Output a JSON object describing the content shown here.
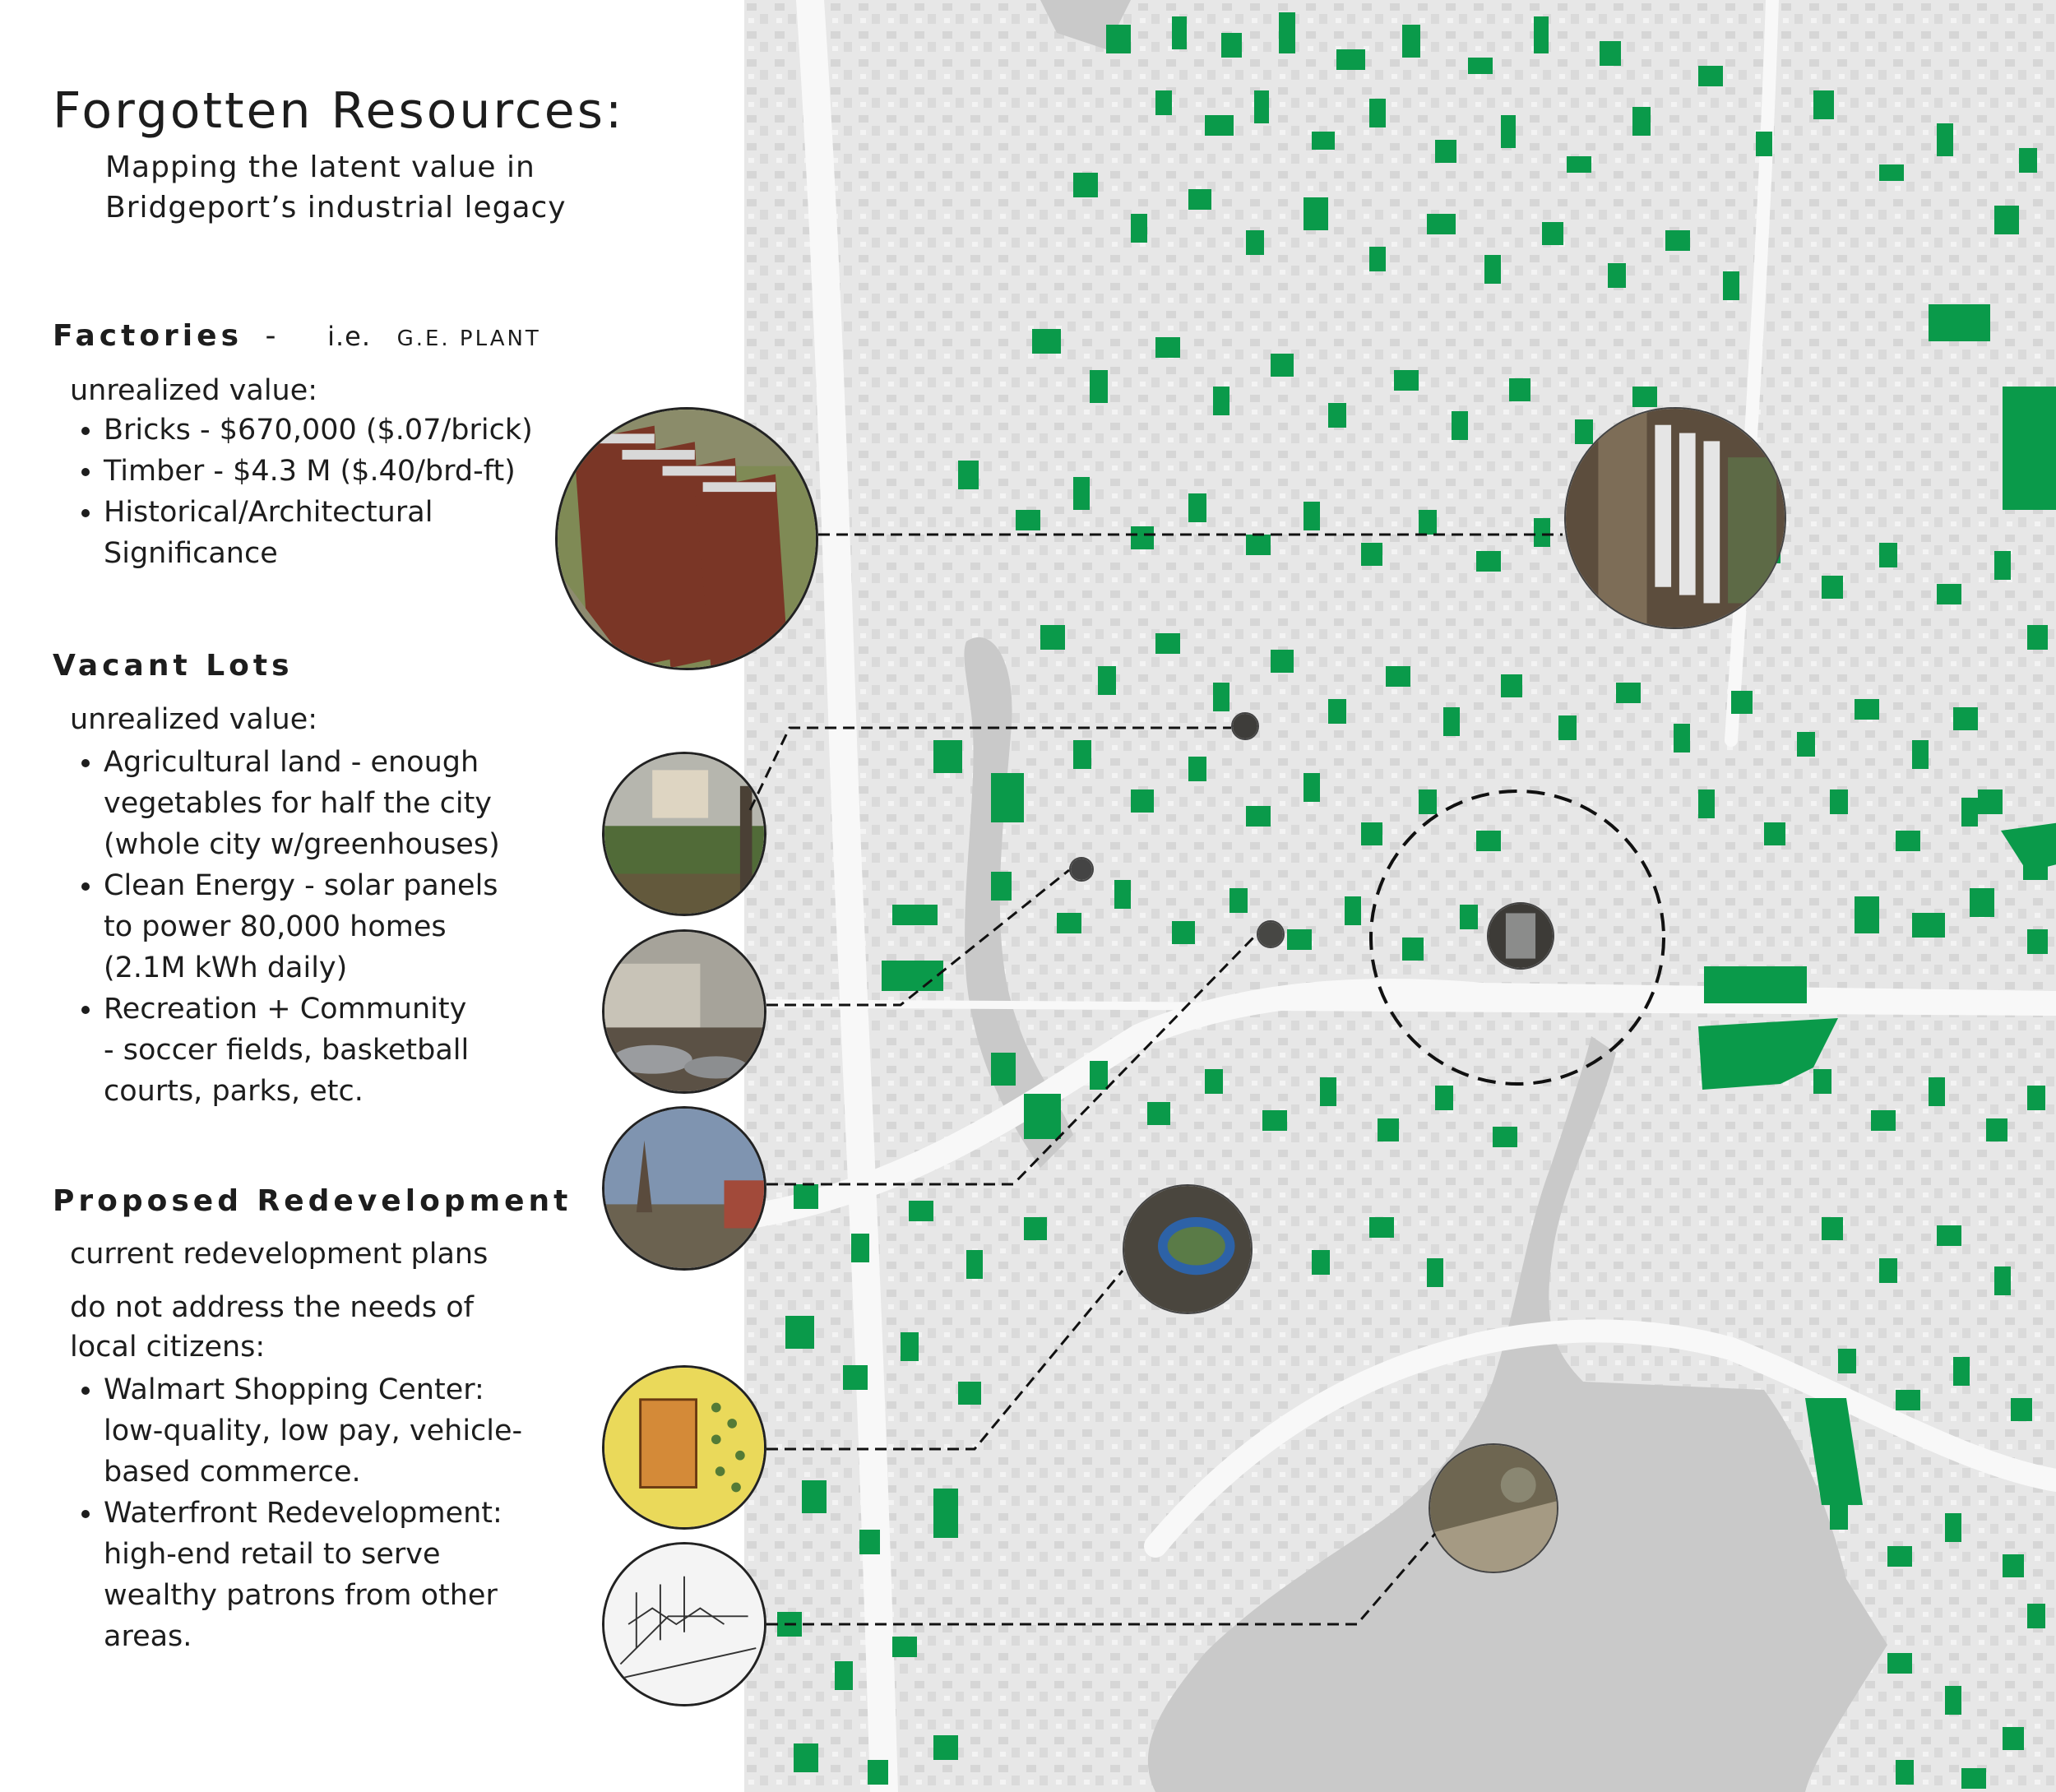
{
  "title": "Forgotten Resources:",
  "subtitle_line1": "Mapping the latent value in",
  "subtitle_line2": "Bridgeport’s industrial legacy",
  "factories": {
    "heading": "Factories",
    "separator": "-",
    "example_prefix": "i.e.",
    "example_name": "G.E. PLANT",
    "label": "unrealized value:",
    "bullets": [
      [
        "Bricks - $670,000 ($.07/brick)"
      ],
      [
        "Timber - $4.3 M ($.40/brd-ft)"
      ],
      [
        "Historical/Architectural",
        "Significance"
      ]
    ]
  },
  "vacant_lots": {
    "heading": "Vacant Lots",
    "label": "unrealized value:",
    "bullets": [
      [
        "Agricultural land - enough",
        "vegetables for half the city",
        "(whole city w/greenhouses)"
      ],
      [
        "Clean Energy - solar panels",
        "to power 80,000 homes",
        "(2.1M kWh daily)"
      ],
      [
        "Recreation + Community",
        "- soccer fields, basketball",
        "courts, parks, etc."
      ]
    ]
  },
  "redevelopment": {
    "heading": "Proposed Redevelopment",
    "line1": "current redevelopment plans",
    "line2": "do not address the needs of",
    "line3": "local citizens:",
    "bullets": [
      [
        "Walmart Shopping Center:",
        "low-quality, low pay, vehicle-",
        "based commerce."
      ],
      [
        "Waterfront Redevelopment:",
        "high-end retail to serve",
        "wealthy patrons from other",
        "areas."
      ]
    ]
  },
  "colors": {
    "vacant_lot_fill": "#0a9a4a",
    "map_background": "#e7e7e7",
    "water": "#c9c9c9",
    "text": "#1d1d1d"
  }
}
